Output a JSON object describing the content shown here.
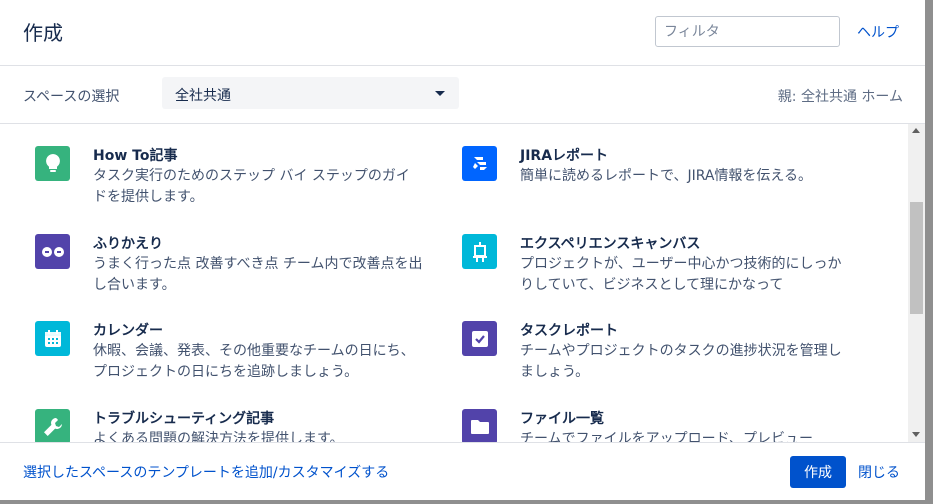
{
  "dialog": {
    "title": "作成",
    "filter_placeholder": "フィルタ",
    "help_label": "ヘルプ"
  },
  "space": {
    "label": "スペースの選択",
    "selected": "全社共通",
    "parent_info": "親: 全社共通 ホーム"
  },
  "templates": [
    {
      "title": "How To記事",
      "description": "タスク実行のためのステップ バイ ステップのガイドを提供します。",
      "icon": "lightbulb-icon",
      "color": "#36b37e"
    },
    {
      "title": "JIRAレポート",
      "description": "簡単に読めるレポートで、JIRA情報を伝える。",
      "icon": "jira-icon",
      "color": "#0065ff"
    },
    {
      "title": "ふりかえり",
      "description": "うまく行った点 改善すべき点 チーム内で改善点を出し合います。",
      "icon": "retrospective-icon",
      "color": "#5243aa"
    },
    {
      "title": "エクスペリエンスキャンバス",
      "description": "プロジェクトが、ユーザー中心かつ技術的にしっかりしていて、ビジネスとして理にかなって",
      "icon": "canvas-icon",
      "color": "#00b8d9"
    },
    {
      "title": "カレンダー",
      "description": "休暇、会議、発表、その他重要なチームの日にち、プロジェクトの日にちを追跡しましょう。",
      "icon": "calendar-icon",
      "color": "#00b8d9"
    },
    {
      "title": "タスクレポート",
      "description": "チームやプロジェクトのタスクの進捗状況を管理しましょう。",
      "icon": "checkbox-icon",
      "color": "#5243aa"
    },
    {
      "title": "トラブルシューティング記事",
      "description": "よくある問題の解決方法を提供します。",
      "icon": "wrench-icon",
      "color": "#36b37e"
    },
    {
      "title": "ファイル一覧",
      "description": "チームでファイルをアップロード、プレビュー",
      "icon": "folder-icon",
      "color": "#5243aa"
    }
  ],
  "footer": {
    "customize_link": "選択したスペースのテンプレートを追加/カスタマイズする",
    "create_label": "作成",
    "close_label": "閉じる"
  }
}
